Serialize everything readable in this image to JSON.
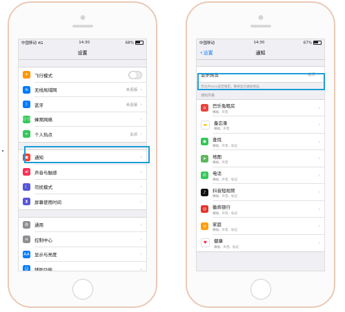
{
  "colors": {
    "accent": "#0a7cff",
    "highlight": "#1a9bd7",
    "phone_frame": "#e9c8b4"
  },
  "left_phone": {
    "status": {
      "carrier": "中国移动 4G",
      "time": "14:30",
      "battery": "68%",
      "battery_level": 0.68
    },
    "title": "设置",
    "group1": [
      {
        "label": "飞行模式",
        "icon": "airplane-icon",
        "color": "#ff9500",
        "glyph": "✈",
        "accessory": "toggle"
      },
      {
        "label": "无线局域网",
        "icon": "wifi-icon",
        "color": "#007aff",
        "glyph": "≋",
        "value": "未连接"
      },
      {
        "label": "蓝牙",
        "icon": "bluetooth-icon",
        "color": "#007aff",
        "glyph": "ᛒ",
        "value": "未连接"
      },
      {
        "label": "蜂窝网络",
        "icon": "cellular-icon",
        "color": "#34c759",
        "glyph": "((·))"
      },
      {
        "label": "个人热点",
        "icon": "hotspot-icon",
        "color": "#34c759",
        "glyph": "∞",
        "value": "关闭"
      }
    ],
    "group2": [
      {
        "label": "通知",
        "icon": "notifications-icon",
        "color": "#ff3b30",
        "glyph": "▣"
      },
      {
        "label": "声音与触感",
        "icon": "sound-icon",
        "color": "#ff2d55",
        "glyph": "◂)"
      },
      {
        "label": "勿扰模式",
        "icon": "moon-icon",
        "color": "#5856d6",
        "glyph": "☾"
      },
      {
        "label": "屏幕使用时间",
        "icon": "hourglass-icon",
        "color": "#5856d6",
        "glyph": "⧗"
      }
    ],
    "group3": [
      {
        "label": "通用",
        "icon": "gear-icon",
        "color": "#8e8e93",
        "glyph": "⚙"
      },
      {
        "label": "控制中心",
        "icon": "control-center-icon",
        "color": "#8e8e93",
        "glyph": "≡"
      },
      {
        "label": "显示与亮度",
        "icon": "display-icon",
        "color": "#007aff",
        "glyph": "AA"
      },
      {
        "label": "辅助功能",
        "icon": "accessibility-icon",
        "color": "#007aff",
        "glyph": "☺"
      }
    ]
  },
  "right_phone": {
    "status": {
      "carrier": "中国移动",
      "time": "14:30",
      "battery": "67%",
      "battery_level": 0.67
    },
    "back_label": "设置",
    "title": "通知",
    "preview": {
      "label": "显示预览",
      "value": "始终"
    },
    "preview_note": "无论iPhone是否锁定，都将显示通知预览。",
    "section_header": "通知风格",
    "apps": [
      {
        "name": "巴乐兔租房",
        "sub": "横幅、声音",
        "icon": "balatu-app-icon",
        "color": "#e8453c",
        "glyph": "⌂"
      },
      {
        "name": "备忘录",
        "sub": "横幅、声音",
        "icon": "notes-app-icon",
        "color": "#ffffff",
        "glyph": "▬"
      },
      {
        "name": "查找",
        "sub": "横幅、声音、标记",
        "icon": "find-my-app-icon",
        "color": "#34c759",
        "glyph": "◉"
      },
      {
        "name": "地图",
        "sub": "横幅、声音",
        "icon": "maps-app-icon",
        "color": "#5cb85c",
        "glyph": "➤"
      },
      {
        "name": "电话",
        "sub": "横幅、声音、标记",
        "icon": "phone-app-icon",
        "color": "#34c759",
        "glyph": "✆"
      },
      {
        "name": "抖音短视频",
        "sub": "横幅、声音、标记",
        "icon": "douyin-app-icon",
        "color": "#111111",
        "glyph": "♪"
      },
      {
        "name": "徽商银行",
        "sub": "横幅、声音、标记",
        "icon": "bank-app-icon",
        "color": "#e3352c",
        "glyph": "◎"
      },
      {
        "name": "家庭",
        "sub": "横幅、声音、标记",
        "icon": "home-app-icon",
        "color": "#ff9f0a",
        "glyph": "⌂"
      },
      {
        "name": "健康",
        "sub": "横幅、声音、标记",
        "icon": "health-app-icon",
        "color": "#ffffff",
        "glyph": "♥"
      }
    ]
  }
}
